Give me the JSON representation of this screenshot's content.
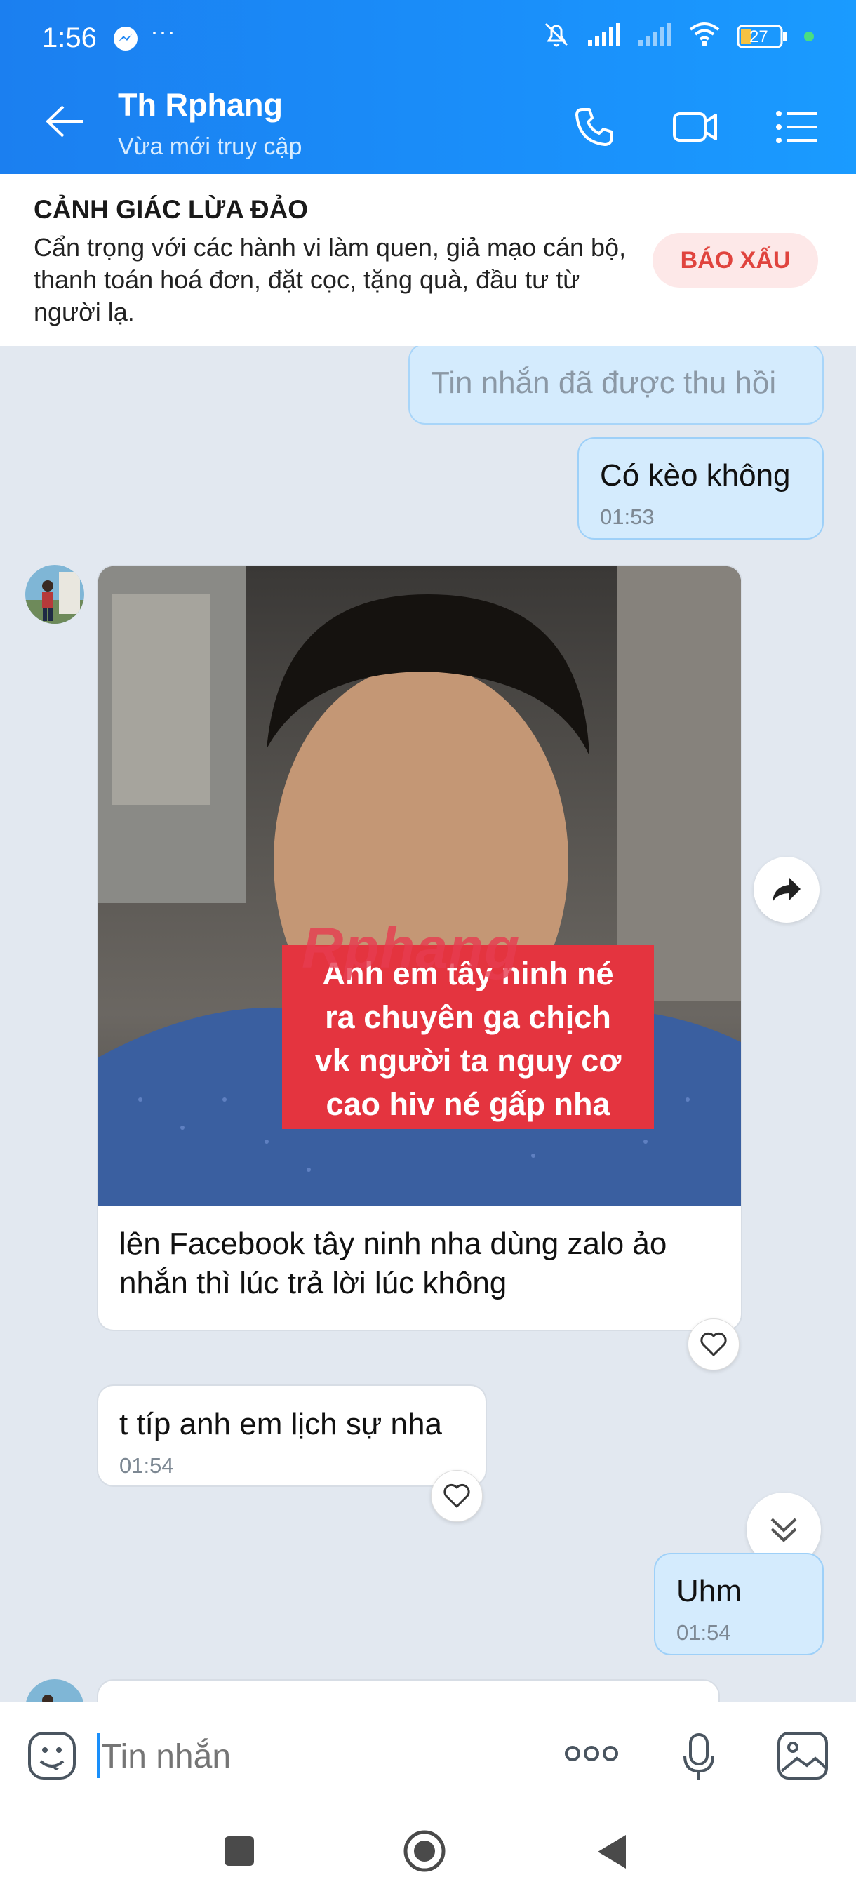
{
  "status_bar": {
    "time": "1:56",
    "battery": "27"
  },
  "header": {
    "title": "Th Rphang",
    "subtitle": "Vừa mới truy cập"
  },
  "warning": {
    "title": "CẢNH GIÁC LỪA ĐẢO",
    "body": "Cẩn trọng với các hành vi làm quen, giả mạo cán bộ, thanh toán hoá đơn, đặt cọc, tặng quà, đầu tư từ người lạ.",
    "report_label": "BÁO XẤU"
  },
  "messages": [
    {
      "type": "recalled",
      "text": "Tin nhắn đã được thu hồi"
    },
    {
      "type": "outgoing",
      "text": "Có kèo không",
      "time": "01:53"
    },
    {
      "type": "incoming-image",
      "watermark": "Rphang",
      "overlay_lines": [
        "Anh em tây ninh né",
        "ra chuyên ga chịch",
        "vk người ta nguy cơ",
        "cao hiv né gấp nha"
      ],
      "caption": "lên Facebook tây ninh nha dùng zalo ảo nhắn thì lúc trả lời lúc không"
    },
    {
      "type": "incoming",
      "text": "t típ anh em lịch sự nha",
      "time": "01:54"
    },
    {
      "type": "outgoing",
      "text": "Uhm",
      "time": "01:54"
    }
  ],
  "input": {
    "placeholder": "Tin nhắn"
  },
  "colors": {
    "header": "#1a8ffa",
    "outgoing_bubble": "#d4ebfd",
    "report": "#e0443e",
    "chat_bg": "#e2e8f0"
  }
}
